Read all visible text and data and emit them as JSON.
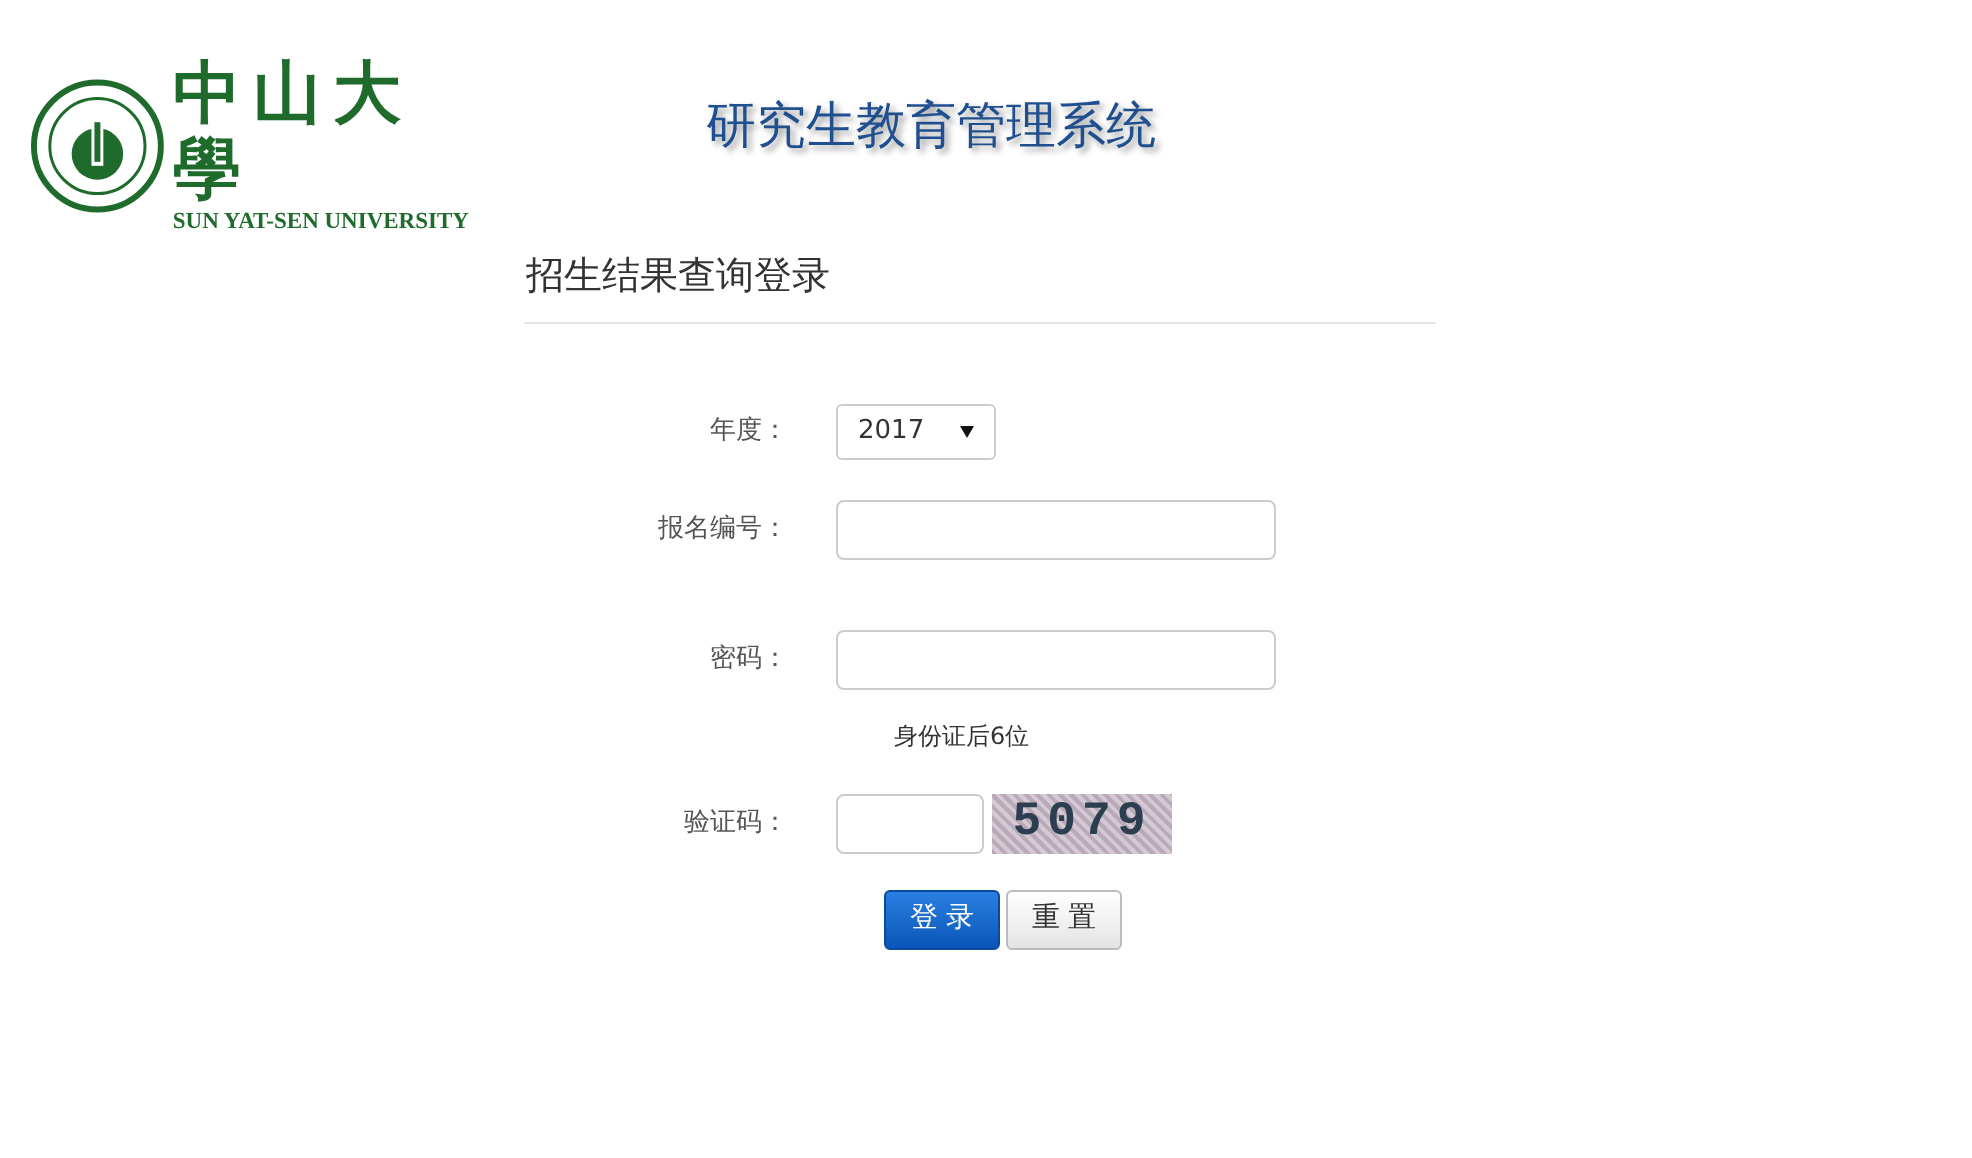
{
  "header": {
    "logo_name": "中山大學",
    "logo_english": "SUN YAT-SEN UNIVERSITY",
    "system_title": "研究生教育管理系统"
  },
  "form": {
    "title": "招生结果查询登录",
    "fields": [
      {
        "kind": "select",
        "label": "年度：",
        "value": "2017"
      },
      {
        "kind": "text",
        "label": "报名编号："
      },
      {
        "kind": "password",
        "label": "密码：",
        "hint": "身份证后6位"
      },
      {
        "kind": "captcha",
        "label": "验证码：",
        "captcha_text": "5079"
      }
    ],
    "buttons": [
      {
        "kind": "primary",
        "label": "登 录"
      },
      {
        "kind": "secondary",
        "label": "重 置"
      }
    ]
  }
}
